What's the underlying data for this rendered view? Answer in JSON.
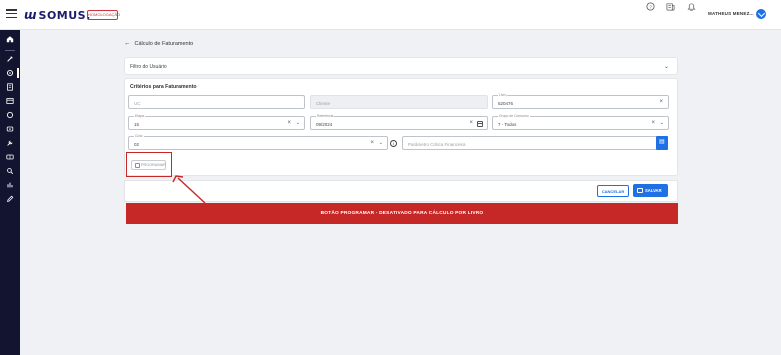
{
  "topbar": {
    "logo_mark": "ɯ",
    "logo_text": "SOMUS.",
    "env_badge": "HOMOLOGAÇÃO",
    "icons": [
      "help-icon",
      "news-icon",
      "notification-icon"
    ],
    "user_name": "MATHEUS MENEZ...",
    "brand_color": "#1c1c6b",
    "accent_color": "#1f6fe5"
  },
  "sidebar": {
    "items": [
      "home-icon",
      "tools-icon",
      "gear-icon",
      "list-icon",
      "card-icon",
      "circle-icon",
      "box-icon",
      "wrench-icon",
      "grid-icon",
      "search-icon",
      "chart-icon",
      "edit-icon"
    ]
  },
  "page": {
    "back_label": "Cálculo de Faturamento",
    "filter_panel_title": "Filtro do Usuário"
  },
  "criteria": {
    "title": "Critérios para Faturamento",
    "uc_placeholder": "UC",
    "cliente_placeholder": "Cliente",
    "livro_label": "Livro",
    "livro_value": "520476",
    "etapa_label": "Etapa",
    "etapa_value": "15",
    "referencia_label": "Referência",
    "referencia_value": "09/2024",
    "grupo_label": "Grupo de Consumo",
    "grupo_value": "7 - Todos",
    "ciclo_label": "Ciclo",
    "ciclo_value": "02",
    "parametro_placeholder": "Parâmetro Crítica Financeira",
    "programar_label": "PROGRAMAR"
  },
  "actions": {
    "cancel_label": "CANCELAR",
    "save_label": "SALVAR"
  },
  "banner": {
    "text": "BOTÃO PROGRAMAR - DESATIVADO PARA CÁLCULO POR LIVRO",
    "color": "#c62828"
  }
}
